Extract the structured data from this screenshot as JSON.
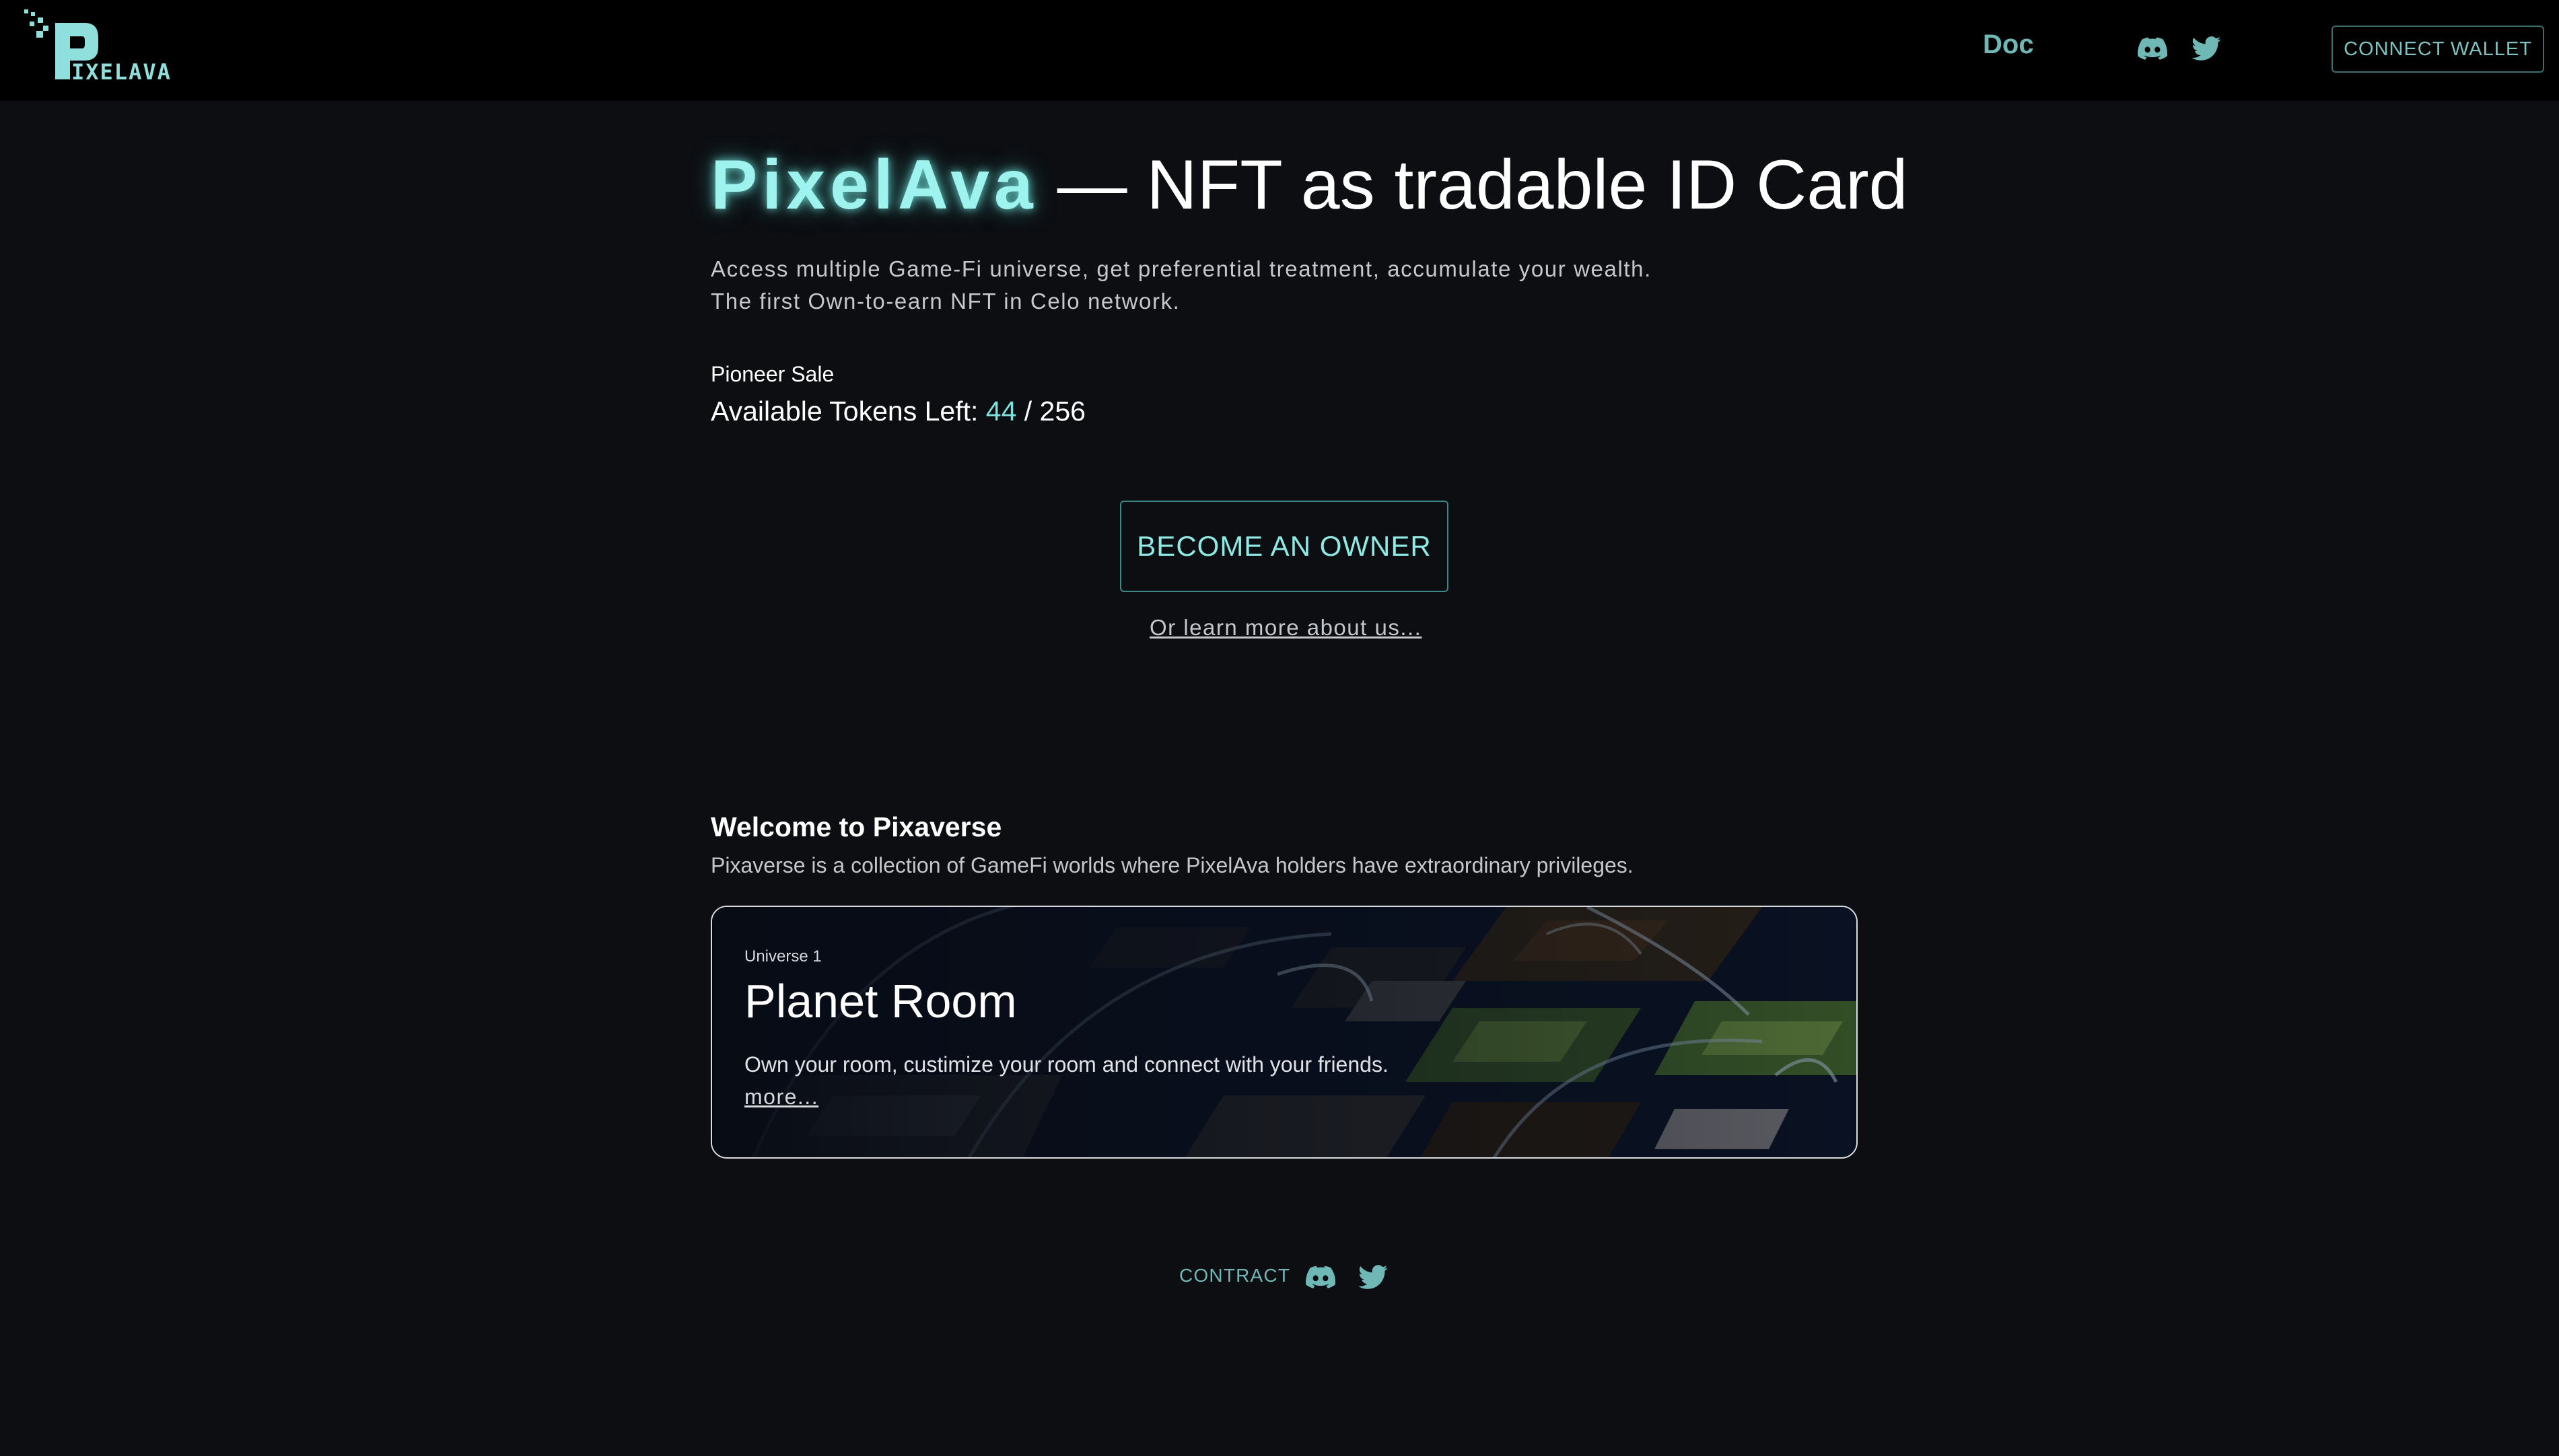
{
  "header": {
    "logo_text": "PIXELAVA",
    "nav_doc": "Doc",
    "social_icons": [
      "discord-icon",
      "twitter-icon"
    ],
    "connect_wallet": "CONNECT WALLET"
  },
  "hero": {
    "brand": "PixelAva",
    "title_rest": " — NFT as tradable ID Card",
    "subtitle_line1": "Access multiple Game-Fi universe, get preferential treatment, accumulate your wealth.",
    "subtitle_line2": "The first Own-to-earn NFT in Celo network.",
    "sale_label": "Pioneer Sale",
    "tokens_label": "Available Tokens Left: ",
    "tokens_left": "44",
    "tokens_total": " / 256",
    "owner_button": "BECOME AN OWNER",
    "learn_more": "Or learn more about us..."
  },
  "pixaverse": {
    "title": "Welcome to Pixaverse",
    "description": "Pixaverse is a collection of GameFi worlds where PixelAva holders have extraordinary privileges.",
    "card": {
      "label": "Universe 1",
      "title": "Planet Room",
      "description": "Own your room, custimize your room and connect with your friends.",
      "more": "more..."
    }
  },
  "footer": {
    "contract": "CONTRACT",
    "social_icons": [
      "discord-icon",
      "twitter-icon"
    ]
  },
  "colors": {
    "background": "#0c0e12",
    "header_bg": "#000000",
    "accent": "#7fe1dc",
    "muted_accent": "#6fb8b6",
    "text": "#ffffff"
  }
}
